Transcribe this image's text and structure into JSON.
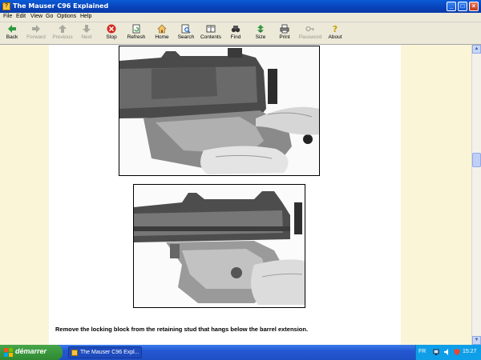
{
  "window": {
    "title": "The Mauser C96 Explained",
    "buttons": {
      "minimize": "_",
      "maximize": "□",
      "close": "×"
    }
  },
  "menu": [
    "File",
    "Edit",
    "View",
    "Go",
    "Options",
    "Help"
  ],
  "toolbar": [
    {
      "label": "Back",
      "icon": "back-arrow-icon",
      "enabled": true
    },
    {
      "label": "Forward",
      "icon": "forward-arrow-icon",
      "enabled": false
    },
    {
      "label": "Previous",
      "icon": "up-arrow-icon",
      "enabled": false
    },
    {
      "label": "Next",
      "icon": "down-arrow-icon",
      "enabled": false
    },
    {
      "label": "Stop",
      "icon": "stop-icon",
      "enabled": true
    },
    {
      "label": "Refresh",
      "icon": "refresh-icon",
      "enabled": true
    },
    {
      "label": "Home",
      "icon": "home-icon",
      "enabled": true
    },
    {
      "label": "Search",
      "icon": "search-icon",
      "enabled": true
    },
    {
      "label": "Contents",
      "icon": "contents-icon",
      "enabled": true
    },
    {
      "label": "Find",
      "icon": "binoculars-icon",
      "enabled": true
    },
    {
      "label": "Size",
      "icon": "size-icon",
      "enabled": true
    },
    {
      "label": "Print",
      "icon": "printer-icon",
      "enabled": true
    },
    {
      "label": "Password",
      "icon": "key-icon",
      "enabled": false
    },
    {
      "label": "About",
      "icon": "about-icon",
      "enabled": true
    }
  ],
  "content": {
    "caption": "Remove the locking block from the retaining stud that hangs below the barrel extension.",
    "photos": [
      {
        "name": "pistol-photo-top",
        "description": "hands holding mauser receiver"
      },
      {
        "name": "pistol-photo-bottom",
        "description": "locking block below barrel extension"
      }
    ]
  },
  "taskbar": {
    "start_label": "démarrer",
    "task_label": "The Mauser C96 Expl...",
    "language": "FR",
    "clock": "15:27"
  },
  "colors": {
    "page_background": "#faf5d7",
    "titlebar": "#0a4fc8",
    "start_button": "#3a9a3d"
  }
}
